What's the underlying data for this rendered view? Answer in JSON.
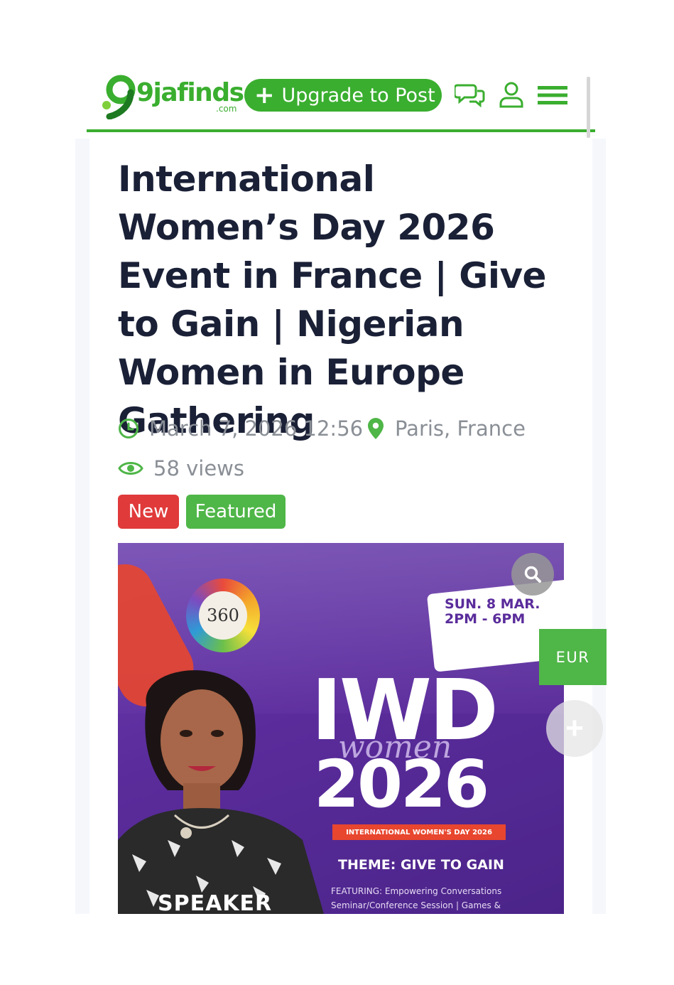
{
  "header": {
    "logo_text": "9jafinds",
    "logo_domain": ".com",
    "upgrade_plus": "+",
    "upgrade_label": "Upgrade to Post",
    "icons": [
      "chat-icon",
      "user-icon",
      "menu-icon"
    ]
  },
  "listing": {
    "title": "International Women’s Day 2026 Event in France | Give to Gain | Nigerian Women in Europe Gathering",
    "datetime": "March 7, 2026 12:56",
    "location": "Paris, France",
    "views": "58 views",
    "badges": {
      "new": "New",
      "featured": "Featured"
    }
  },
  "poster": {
    "date_line1": "SUN. 8 MAR.",
    "date_line2": "2PM - 6PM",
    "logo_text": "360",
    "iwd": "IWD",
    "script": "women",
    "year": "2026",
    "bar_text": "INTERNATIONAL WOMEN'S DAY 2026",
    "theme": "THEME: GIVE TO GAIN",
    "featuring_line1": "FEATURING: Empowering Conversations",
    "featuring_line2": "Seminar/Conference Session | Games &",
    "speaker_label": "SPEAKER"
  },
  "floating": {
    "currency": "EUR",
    "add": "+"
  },
  "colors": {
    "brand_green": "#3aae2f",
    "badge_new": "#e03a3a",
    "badge_featured": "#4fb648",
    "title_text": "#1a2036",
    "meta_text": "#8a8f96",
    "poster_purple": "#5a2c9b"
  }
}
